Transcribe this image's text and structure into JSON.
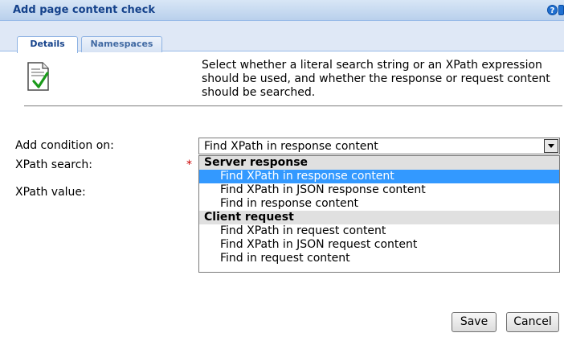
{
  "dialog": {
    "title": "Add page content check",
    "help_glyph": "?",
    "close_glyph": "x"
  },
  "tabs": [
    {
      "label": "Details",
      "active": true
    },
    {
      "label": "Namespaces",
      "active": false
    }
  ],
  "icon": "document-check-icon",
  "description": "Select whether a literal search string or an XPath expression should be used, and whether the response or request content should be searched.",
  "form": {
    "condition_label": "Add condition on:",
    "search_label": "XPath search:",
    "required_marker": "*",
    "value_label": "XPath value:",
    "condition_selected": "Find XPath in response content"
  },
  "dropdown": {
    "groups": [
      {
        "label": "Server response",
        "options": [
          "Find XPath in response content",
          "Find XPath in JSON response content",
          "Find in response content"
        ]
      },
      {
        "label": "Client request",
        "options": [
          "Find XPath in request content",
          "Find XPath in JSON request content",
          "Find in request content"
        ]
      }
    ],
    "highlighted": "Find XPath in response content"
  },
  "buttons": {
    "save": "Save",
    "cancel": "Cancel"
  },
  "colors": {
    "title_text": "#15428b",
    "highlight": "#3399ff",
    "required": "#cc0000"
  }
}
